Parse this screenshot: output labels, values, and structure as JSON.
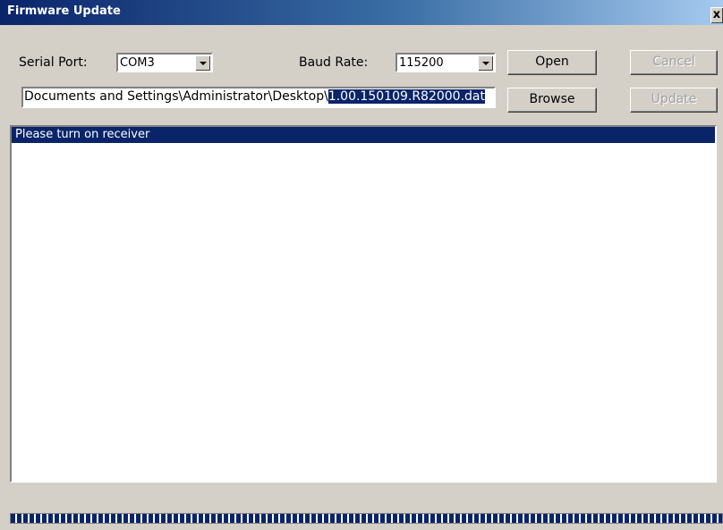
{
  "window": {
    "title": "Firmware Update",
    "close_label": "x"
  },
  "serial_port": {
    "label": "Serial Port:",
    "value": "COM3"
  },
  "baud_rate": {
    "label": "Baud Rate:",
    "value": "115200"
  },
  "buttons": {
    "open": "Open",
    "cancel": "Cancel",
    "browse": "Browse",
    "update": "Update"
  },
  "file_path": {
    "unselected": "Documents and Settings\\Administrator\\Desktop\\",
    "selected": "1.00.150109.R82000.dat"
  },
  "log": {
    "lines": [
      "Please turn on receiver"
    ]
  },
  "progress": {
    "value": 1.0
  },
  "colors": {
    "title_bar": "#0a246a",
    "selection": "#0a246a",
    "face": "#d4d0c8"
  }
}
